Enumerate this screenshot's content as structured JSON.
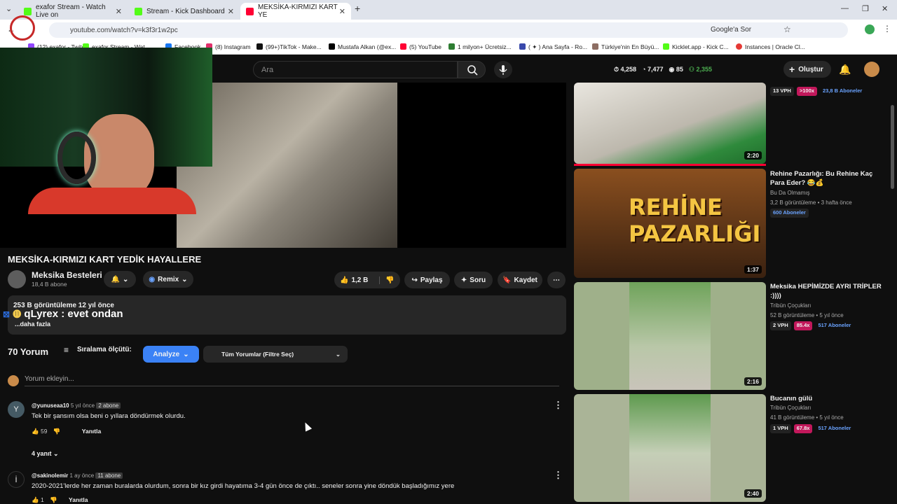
{
  "browser": {
    "tabs": [
      {
        "label": "exafor Stream - Watch Live on",
        "color": "#53fc18"
      },
      {
        "label": "Stream - Kick Dashboard",
        "color": "#53fc18"
      },
      {
        "label": "MEKSİKA-KIRMIZI KART YE",
        "color": "#ff0033"
      }
    ],
    "new_tab": "+",
    "url": "youtube.com/watch?v=k3f3r1w2pc",
    "google_ask": "Google'a Sor",
    "bookmarks": [
      "(12) exafor - Twitch",
      "exafor Stream - Wat",
      "Facebook",
      "(8) Instagram",
      "(99+)TikTok - Make...",
      "Mustafa Alkan (@ex...",
      "(5) YouTube",
      "1 milyon+ Ücretsiz...",
      "( ✦ ) Ana Sayfa - Ro...",
      "Türkiye'nin En Büyü...",
      "Kicklet.app - Kick C...",
      "Instances | Oracle Cl..."
    ]
  },
  "yt": {
    "search_placeholder": "Ara",
    "stats": {
      "views": "4,258",
      "eye": "7,477",
      "live": "85",
      "users": "2,355"
    },
    "create": "Oluştur"
  },
  "video": {
    "title": "MEKSİKA-KIRMIZI KART YEDİK HAYALLERE",
    "channel": "Meksika Besteleri",
    "subscribers": "18,4 B abone",
    "remix": "Remix",
    "likes": "1,2 B",
    "share": "Paylaş",
    "ask": "Soru",
    "save": "Kaydet",
    "views_line": "253 B görüntüleme  12 yıl önce",
    "more": "...daha fazla",
    "overlay": "qLyrex : evet ondan"
  },
  "comments": {
    "count": "70 Yorum",
    "sort": "Sıralama ölçütü:",
    "analyze": "Analyze",
    "filter": "Tüm Yorumlar (Filtre Seç)",
    "add_placeholder": "Yorum ekleyin...",
    "items": [
      {
        "user": "@yunuseaa10",
        "time": "5 yıl önce",
        "badge": "2 abone",
        "text": "Tek bir şansım olsa beni o yıllara döndürmek olurdu.",
        "likes": "59",
        "reply": "Yanıtla",
        "replies": "4 yanıt",
        "avatar": "Y"
      },
      {
        "user": "@sakinolemir",
        "time": "1 ay önce",
        "badge": "11 abone",
        "text": "2020-2021'lerde her zaman buralarda olurdum, sonra bir kız girdi hayatıma 3-4 gün önce de çıktı.. seneler sonra yine döndük başladığımız yere",
        "likes": "1",
        "reply": "Yanıtla",
        "avatar": "İ"
      }
    ]
  },
  "sidebar": [
    {
      "title": "",
      "channel": "",
      "meta": "",
      "vph": "13 VPH",
      "mult": ">100x",
      "subs": "23,8 B Aboneler",
      "duration": "2:20"
    },
    {
      "title": "Rehine Pazarlığı: Bu Rehine Kaç Para Eder? 😂💰",
      "channel": "Bu Da Olmamış",
      "meta": "3,2 B görüntüleme • 3 hafta önce",
      "vph": "",
      "mult": "",
      "subs": "600 Aboneler",
      "duration": "1:37",
      "thumb_text": "REHİNE PAZARLIĞI"
    },
    {
      "title": "Meksika HEPİMİZDE AYRI TRİPLER :))))",
      "channel": "Tribün Çoçukları",
      "meta": "52 B görüntüleme • 5 yıl önce",
      "vph": "2 VPH",
      "mult": "85.4x",
      "subs": "517 Aboneler",
      "duration": "2:16"
    },
    {
      "title": "Bucanın gülü",
      "channel": "Tribün Çoçukları",
      "meta": "41 B görüntüleme • 5 yıl önce",
      "vph": "1 VPH",
      "mult": "67.8x",
      "subs": "517 Aboneler",
      "duration": "2:40"
    }
  ]
}
